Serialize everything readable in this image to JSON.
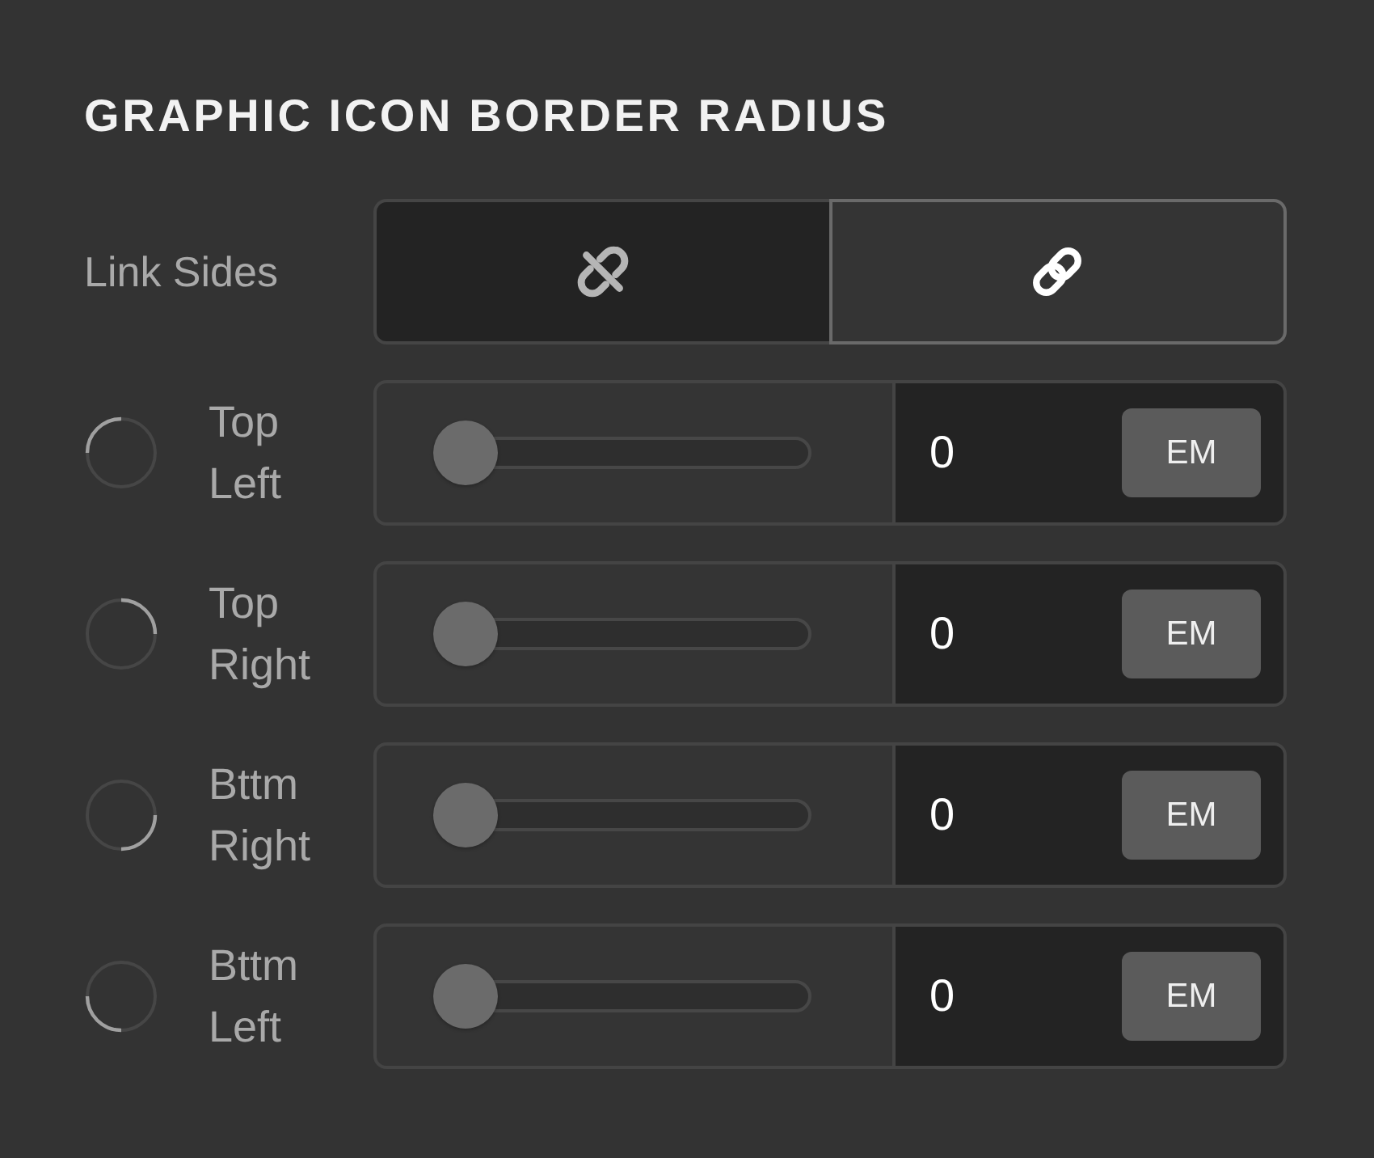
{
  "panel": {
    "title": "GRAPHIC ICON BORDER RADIUS"
  },
  "link_sides": {
    "label": "Link Sides",
    "options": [
      {
        "kind": "unlink",
        "selected": false
      },
      {
        "kind": "link",
        "selected": true
      }
    ]
  },
  "corners": [
    {
      "kind": "top_left",
      "label": "Top Left",
      "level": 0,
      "value": "0",
      "unit": "EM"
    },
    {
      "kind": "top_right",
      "label": "Top Right",
      "level": 0,
      "value": "0",
      "unit": "EM"
    },
    {
      "kind": "bottom_right",
      "label": "Bttm Right",
      "level": 0,
      "value": "0",
      "unit": "EM"
    },
    {
      "kind": "bottom_left",
      "label": "Bttm Left",
      "level": 0,
      "value": "0",
      "unit": "EM"
    }
  ]
}
